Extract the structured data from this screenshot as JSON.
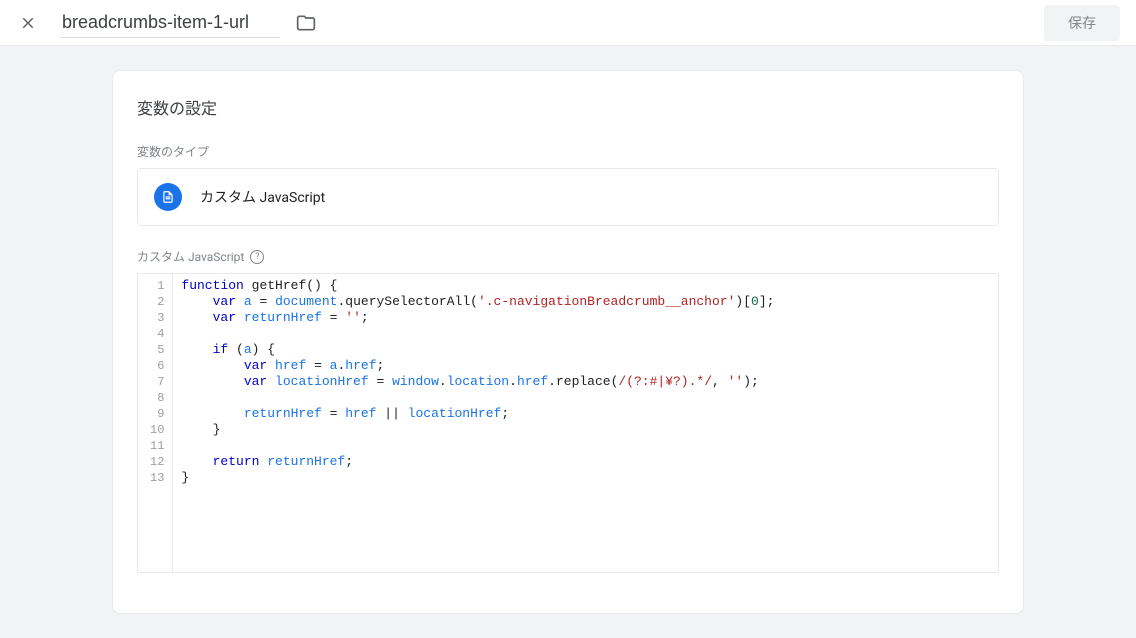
{
  "header": {
    "title_value": "breadcrumbs-item-1-url",
    "save_label": "保存"
  },
  "card": {
    "section_title": "変数の設定",
    "type_label": "変数のタイプ",
    "selected_type": "カスタム JavaScript",
    "code_label": "カスタム JavaScript",
    "help_tooltip": "?"
  },
  "code": {
    "lines": [
      {
        "n": 1,
        "tokens": [
          {
            "t": "function",
            "c": "tok-kw"
          },
          {
            "t": " "
          },
          {
            "t": "getHref",
            "c": ""
          },
          {
            "t": "() {"
          }
        ]
      },
      {
        "n": 2,
        "tokens": [
          {
            "t": "    "
          },
          {
            "t": "var",
            "c": "tok-kw"
          },
          {
            "t": " "
          },
          {
            "t": "a",
            "c": "tok-id"
          },
          {
            "t": " = "
          },
          {
            "t": "document",
            "c": "tok-id"
          },
          {
            "t": "."
          },
          {
            "t": "querySelectorAll",
            "c": ""
          },
          {
            "t": "("
          },
          {
            "t": "'.c-navigationBreadcrumb__anchor'",
            "c": "tok-str"
          },
          {
            "t": ")["
          },
          {
            "t": "0",
            "c": "tok-num"
          },
          {
            "t": "];"
          }
        ]
      },
      {
        "n": 3,
        "tokens": [
          {
            "t": "    "
          },
          {
            "t": "var",
            "c": "tok-kw"
          },
          {
            "t": " "
          },
          {
            "t": "returnHref",
            "c": "tok-id"
          },
          {
            "t": " = "
          },
          {
            "t": "''",
            "c": "tok-str"
          },
          {
            "t": ";"
          }
        ]
      },
      {
        "n": 4,
        "tokens": []
      },
      {
        "n": 5,
        "tokens": [
          {
            "t": "    "
          },
          {
            "t": "if",
            "c": "tok-kw"
          },
          {
            "t": " ("
          },
          {
            "t": "a",
            "c": "tok-id"
          },
          {
            "t": ") {"
          }
        ]
      },
      {
        "n": 6,
        "tokens": [
          {
            "t": "        "
          },
          {
            "t": "var",
            "c": "tok-kw"
          },
          {
            "t": " "
          },
          {
            "t": "href",
            "c": "tok-id"
          },
          {
            "t": " = "
          },
          {
            "t": "a",
            "c": "tok-id"
          },
          {
            "t": "."
          },
          {
            "t": "href",
            "c": "tok-id"
          },
          {
            "t": ";"
          }
        ]
      },
      {
        "n": 7,
        "tokens": [
          {
            "t": "        "
          },
          {
            "t": "var",
            "c": "tok-kw"
          },
          {
            "t": " "
          },
          {
            "t": "locationHref",
            "c": "tok-id"
          },
          {
            "t": " = "
          },
          {
            "t": "window",
            "c": "tok-id"
          },
          {
            "t": "."
          },
          {
            "t": "location",
            "c": "tok-id"
          },
          {
            "t": "."
          },
          {
            "t": "href",
            "c": "tok-id"
          },
          {
            "t": "."
          },
          {
            "t": "replace",
            "c": ""
          },
          {
            "t": "("
          },
          {
            "t": "/(?:#|¥?).*/",
            "c": "tok-regex"
          },
          {
            "t": ", "
          },
          {
            "t": "''",
            "c": "tok-str"
          },
          {
            "t": ");"
          }
        ]
      },
      {
        "n": 8,
        "tokens": []
      },
      {
        "n": 9,
        "tokens": [
          {
            "t": "        "
          },
          {
            "t": "returnHref",
            "c": "tok-id"
          },
          {
            "t": " = "
          },
          {
            "t": "href",
            "c": "tok-id"
          },
          {
            "t": " || "
          },
          {
            "t": "locationHref",
            "c": "tok-id"
          },
          {
            "t": ";"
          }
        ]
      },
      {
        "n": 10,
        "tokens": [
          {
            "t": "    }"
          }
        ]
      },
      {
        "n": 11,
        "tokens": []
      },
      {
        "n": 12,
        "tokens": [
          {
            "t": "    "
          },
          {
            "t": "return",
            "c": "tok-kw"
          },
          {
            "t": " "
          },
          {
            "t": "returnHref",
            "c": "tok-id"
          },
          {
            "t": ";"
          }
        ]
      },
      {
        "n": 13,
        "tokens": [
          {
            "t": "}"
          }
        ]
      }
    ]
  }
}
